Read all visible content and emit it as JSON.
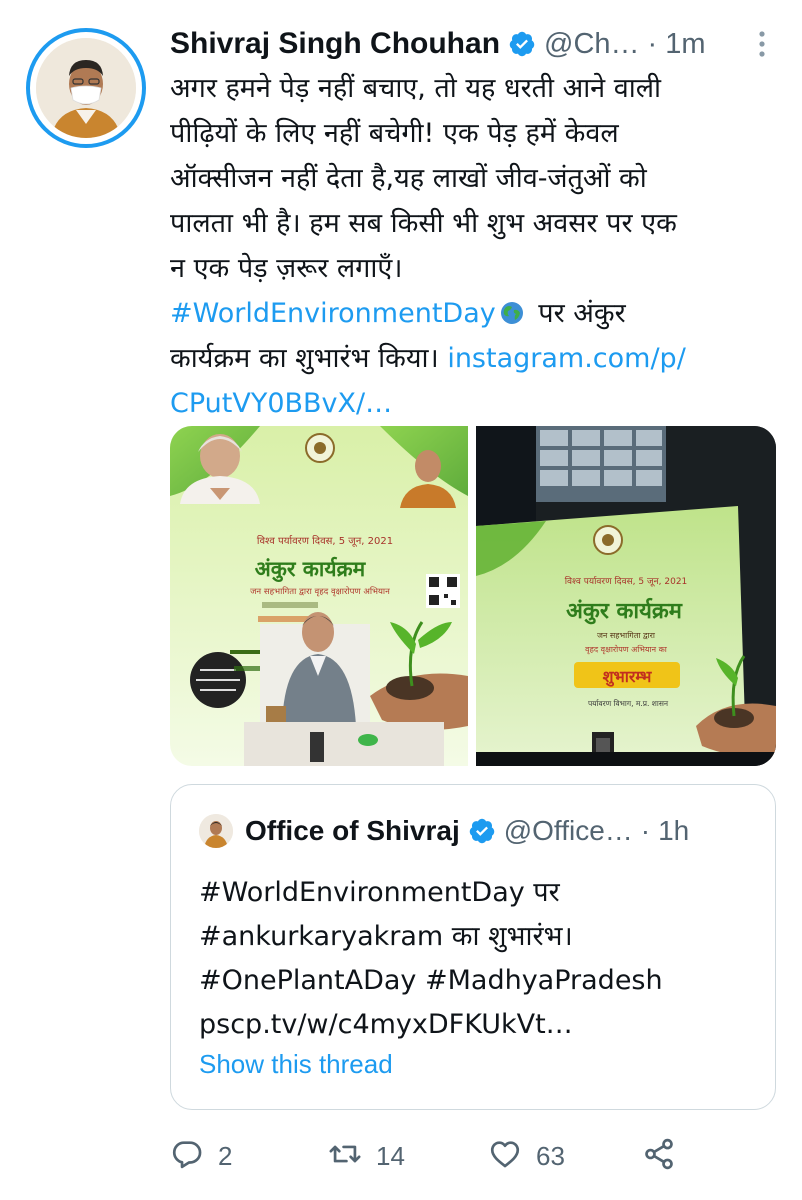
{
  "tweet": {
    "author_name": "Shivraj Singh Chouhan",
    "handle": "@Ch…",
    "separator": "·",
    "time": "1m",
    "lines": [
      "अगर हमने पेड़ नहीं बचाए, तो यह धरती आने वाली",
      "पीढ़ियों के लिए नहीं बचेगी! एक पेड़ हमें केवल",
      "ऑक्सीजन नहीं देता है,यह लाखों जीव-जंतुओं को",
      "पालता भी है। हम सब किसी भी शुभ अवसर पर एक",
      "न एक पेड़ ज़रूर लगाएँ।"
    ],
    "hashtag": "#WorldEnvironmentDay",
    "after_hashtag": " पर अंकुर",
    "line_program": "कार्यक्रम का शुभारंभ किया। ",
    "link_part1": "instagram.com/p/",
    "link_part2": "CPutVY0BBvX/…"
  },
  "media": {
    "left": {
      "title_date": "विश्व पर्यावरण दिवस, 5 जून, 2021",
      "program": "अंकुर कार्यक्रम",
      "subtitle": "जन सहभागिता द्वारा वृहद वृक्षारोपण अभियान"
    },
    "right": {
      "title_date": "विश्व पर्यावरण दिवस, 5 जून, 2021",
      "program": "अंकुर कार्यक्रम",
      "subtitle1": "जन सहभागिता द्वारा",
      "subtitle2": "वृहद वृक्षारोपण अभियान का",
      "launch": "शुभारम्भ",
      "dept": "पर्यावरण विभाग, म.प्र. शासन"
    }
  },
  "quote": {
    "author_name": "Office of Shivraj",
    "handle": "@Office…",
    "separator": "·",
    "time": "1h",
    "lines": [
      "#WorldEnvironmentDay पर",
      "#ankurkaryakram का शुभारंभ।",
      "#OnePlantADay #MadhyaPradesh",
      "pscp.tv/w/c4myxDFKUkVt…"
    ],
    "show_thread": "Show this thread"
  },
  "actions": {
    "replies": "2",
    "retweets": "14",
    "likes": "63"
  },
  "colors": {
    "accent": "#1d9bf0",
    "text": "#0f1419",
    "muted": "#536471",
    "border": "#cfd9de"
  }
}
